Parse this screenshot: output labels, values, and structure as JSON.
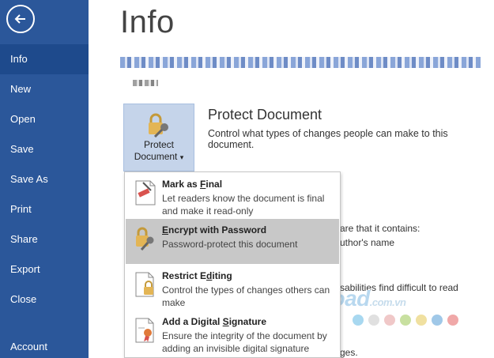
{
  "sidebar": {
    "items": [
      {
        "label": "Info"
      },
      {
        "label": "New"
      },
      {
        "label": "Open"
      },
      {
        "label": "Save"
      },
      {
        "label": "Save As"
      },
      {
        "label": "Print"
      },
      {
        "label": "Share"
      },
      {
        "label": "Export"
      },
      {
        "label": "Close"
      },
      {
        "label": "Account"
      }
    ],
    "active": "Info",
    "accent": "#2b579a"
  },
  "main": {
    "title": "Info",
    "protect": {
      "button_line1": "Protect",
      "button_line2": "Document",
      "caret": "▾",
      "heading": "Protect Document",
      "description": "Control what types of changes people can make to this document."
    },
    "background_text": {
      "inspect_line": "are that it contains:",
      "author_line": "uthor's name",
      "disability_line": "sabilities find difficult to read",
      "last_line": "ges."
    }
  },
  "dropdown": {
    "items": [
      {
        "title_pre": "Mark as ",
        "title_u": "F",
        "title_post": "inal",
        "desc": "Let readers know the document is final and make it read-only",
        "icon": "mark-final-icon"
      },
      {
        "title_pre": "",
        "title_u": "E",
        "title_post": "ncrypt with Password",
        "desc": "Password-protect this document",
        "icon": "lock-key-icon"
      },
      {
        "title_pre": "Restrict E",
        "title_u": "d",
        "title_post": "iting",
        "desc": "Control the types of changes others can make",
        "icon": "restrict-editing-icon"
      },
      {
        "title_pre": "Add a Digital ",
        "title_u": "S",
        "title_post": "ignature",
        "desc": "Ensure the integrity of the document by adding an invisible digital signature",
        "icon": "digital-signature-icon"
      }
    ],
    "highlighted_index": 1,
    "highlight_color": "#c8c8c8"
  },
  "watermark": {
    "brand": "Download",
    "suffix": ".com.vn",
    "dot_colors": [
      "#a8d8f0",
      "#e0e0e0",
      "#f0c8c8",
      "#c8e0a0",
      "#f0e0a0",
      "#a0c8e8",
      "#f0a8a8"
    ]
  }
}
